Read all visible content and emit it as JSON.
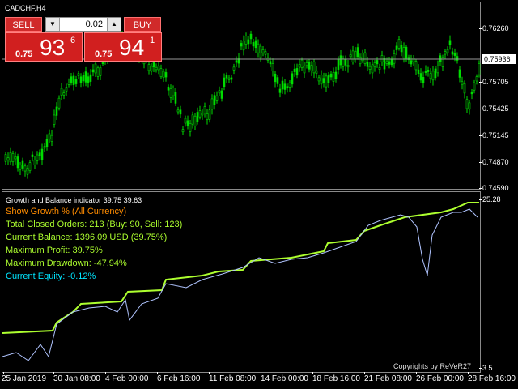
{
  "chart": {
    "symbol": "CADCHF,H4",
    "current_price": "0.75936",
    "price_ticks": [
      "0.76260",
      "0.75705",
      "0.75425",
      "0.75145",
      "0.74870",
      "0.74590"
    ],
    "colors": {
      "candles": "#00dd00",
      "price_line": "#999999",
      "background": "#000000"
    }
  },
  "trade_panel": {
    "sell_label": "SELL",
    "buy_label": "BUY",
    "lot_value": "0.02",
    "down_arrow": "▼",
    "up_arrow": "▲",
    "sell_prefix": "0.75",
    "sell_big": "93",
    "sell_pip": "6",
    "buy_prefix": "0.75",
    "buy_big": "94",
    "buy_pip": "1"
  },
  "indicator": {
    "title": "Growth and Balance indicator 39.75 39.63",
    "show_growth": "Show Growth % (All Currency)",
    "total_orders": "Total Closed Orders: 213 (Buy: 90, Sell: 123)",
    "current_balance": "Current Balance: 1396.09 USD (39.75%)",
    "max_profit": "Maximum Profit: 39.75%",
    "max_drawdown": "Maximum Drawdown: -47.94%",
    "current_equity": "Current Equity: -0.12%",
    "axis_top": "25.28",
    "axis_bottom": "3.5",
    "copyright": "Copyrights by ReVeR27",
    "colors": {
      "balance": "#adff2f",
      "equity": "#b0c4ff",
      "growth_text": "#ff8c00",
      "stats_text": "#adff2f",
      "equity_text": "#00e5ff"
    }
  },
  "time_axis": [
    "25 Jan 2019",
    "30 Jan 08:00",
    "4 Feb 00:00",
    "6 Feb 16:00",
    "11 Feb 08:00",
    "14 Feb 00:00",
    "18 Feb 16:00",
    "21 Feb 08:00",
    "26 Feb 00:00",
    "28 Feb 16:00"
  ]
}
